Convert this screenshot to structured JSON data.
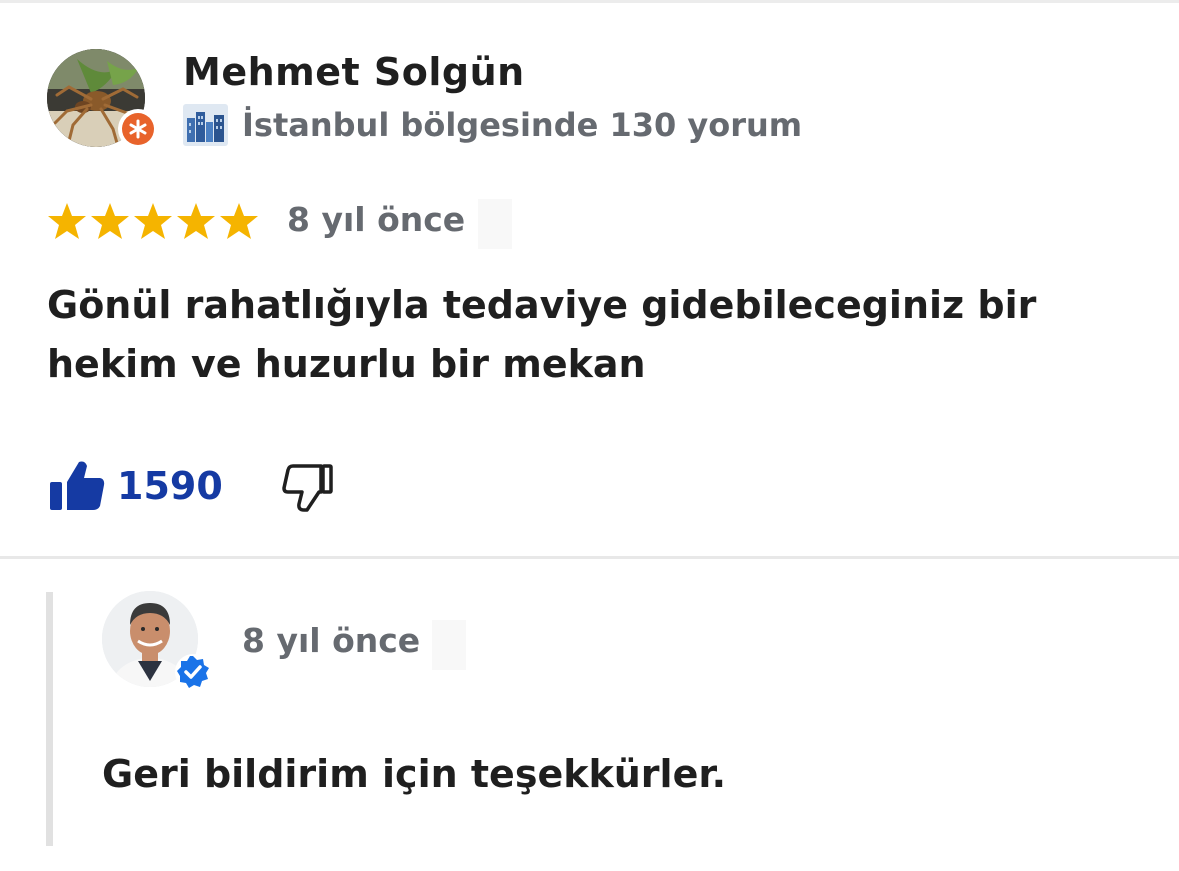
{
  "review": {
    "author": {
      "name": "Mehmet Solgün",
      "meta": "İstanbul bölgesinde 130 yorum",
      "avatar_icon": "spider-photo-avatar",
      "badge_icon": "local-guide-badge-icon",
      "meta_icon": "city-skyline-icon"
    },
    "rating": 5,
    "rating_max": 5,
    "star_color": "#f5b400",
    "date": "8 yıl önce",
    "text": "Gönül rahatlığıyla tedaviye gidebileceginiz bir hekim ve huzurlu bir mekan",
    "likes": {
      "count": "1590",
      "icon": "thumbs-up-filled-icon",
      "color": "#153aa3"
    },
    "dislike": {
      "icon": "thumbs-down-outline-icon"
    }
  },
  "reply": {
    "avatar_icon": "owner-photo-avatar",
    "badge_icon": "verified-check-icon",
    "badge_color": "#1a73e8",
    "date": "8 yıl önce",
    "text": "Geri bildirim için teşekkürler."
  }
}
